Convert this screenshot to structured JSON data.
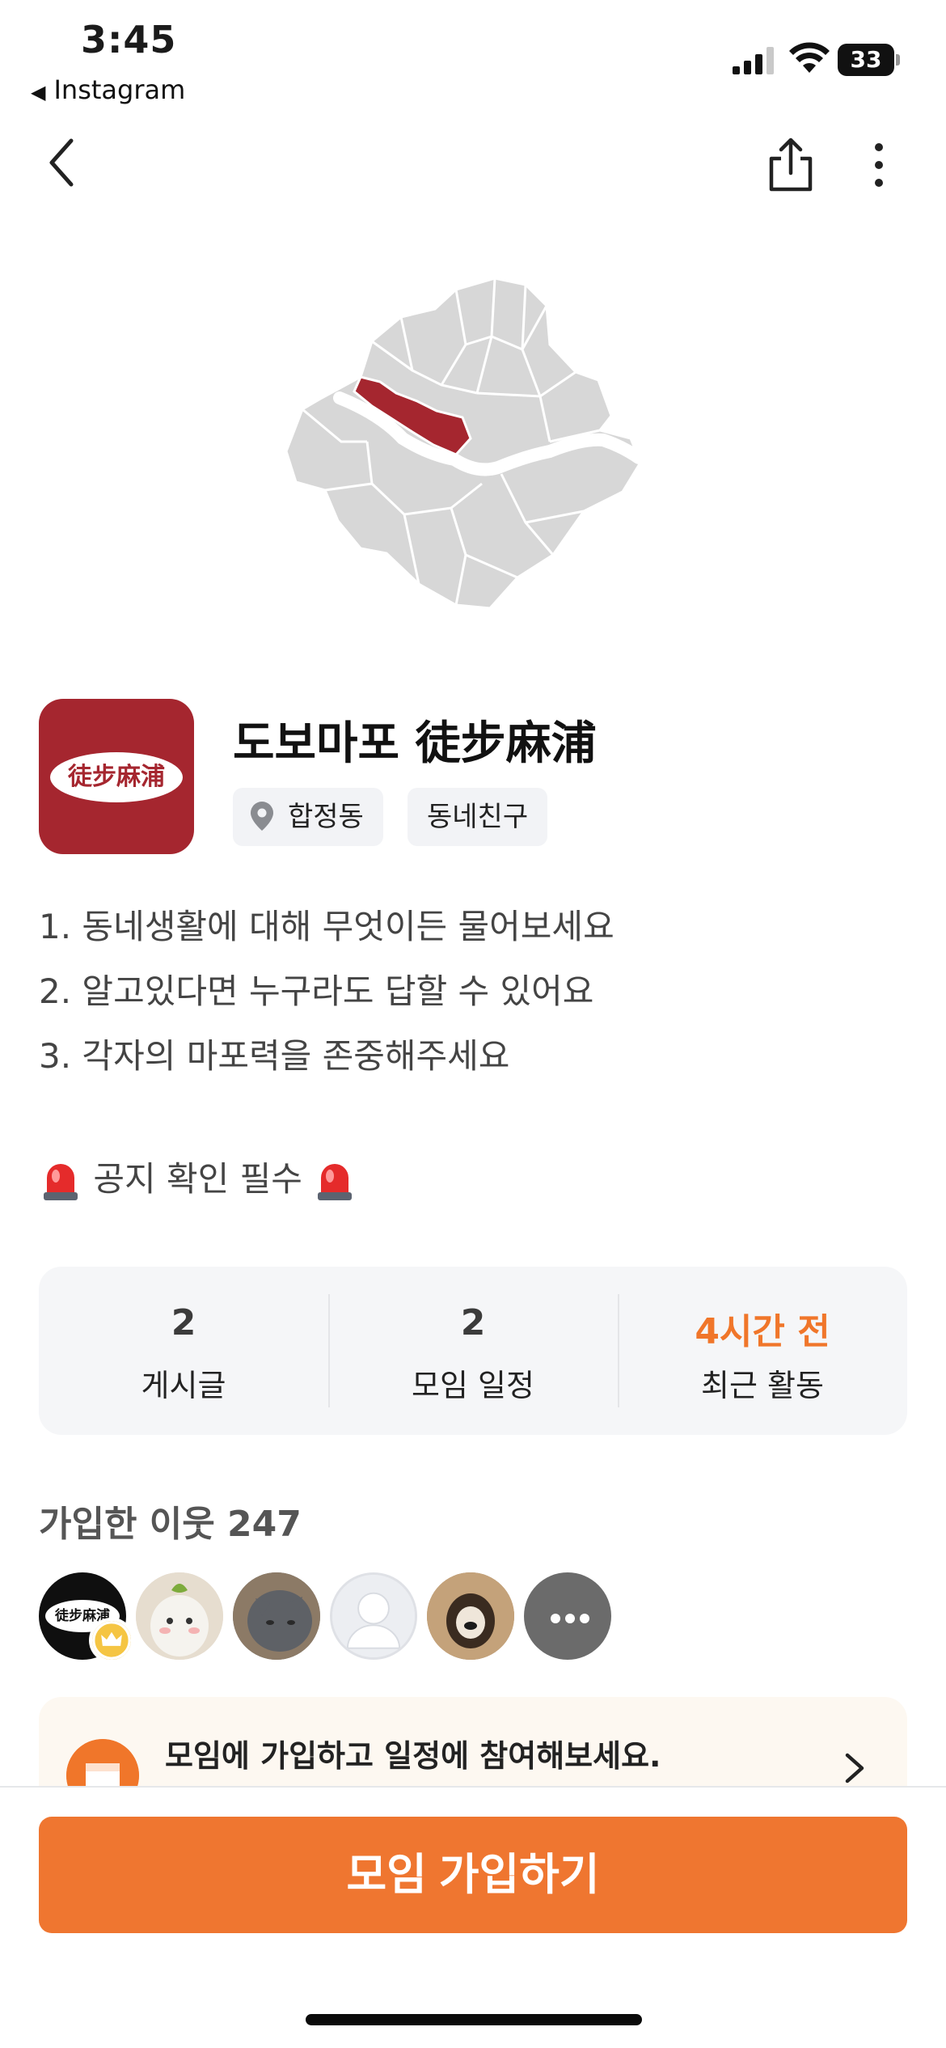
{
  "status_bar": {
    "time": "3:45",
    "back_app": "Instagram",
    "battery": "33"
  },
  "nav": {
    "back_icon": "chevron-left-icon",
    "share_icon": "share-icon",
    "more_icon": "more-vertical-icon"
  },
  "map": {
    "highlight_color": "#a5262f",
    "base_color": "#d7d7d7"
  },
  "group": {
    "logo_text": "徒步麻浦",
    "title": "도보마포 徒步麻浦",
    "location": "합정동",
    "category": "동네친구"
  },
  "description": {
    "lines": [
      "1. 동네생활에 대해 무엇이든 물어보세요",
      "2. 알고있다면 누구라도 답할 수 있어요",
      "3. 각자의 마포력을 존중해주세요"
    ],
    "notice": "공지 확인 필수"
  },
  "stats": [
    {
      "value": "2",
      "label": "게시글"
    },
    {
      "value": "2",
      "label": "모임 일정"
    },
    {
      "value": "4시간 전",
      "label": "최근 활동"
    }
  ],
  "members": {
    "title": "가입한 이웃 247",
    "leader_avatar_text": "徒步麻浦"
  },
  "banner": {
    "text": "모임에 가입하고 일정에 참여해보세요."
  },
  "join_button": {
    "label": "모임 가입하기"
  },
  "colors": {
    "accent": "#ef7630",
    "brand_red": "#a5262f"
  }
}
